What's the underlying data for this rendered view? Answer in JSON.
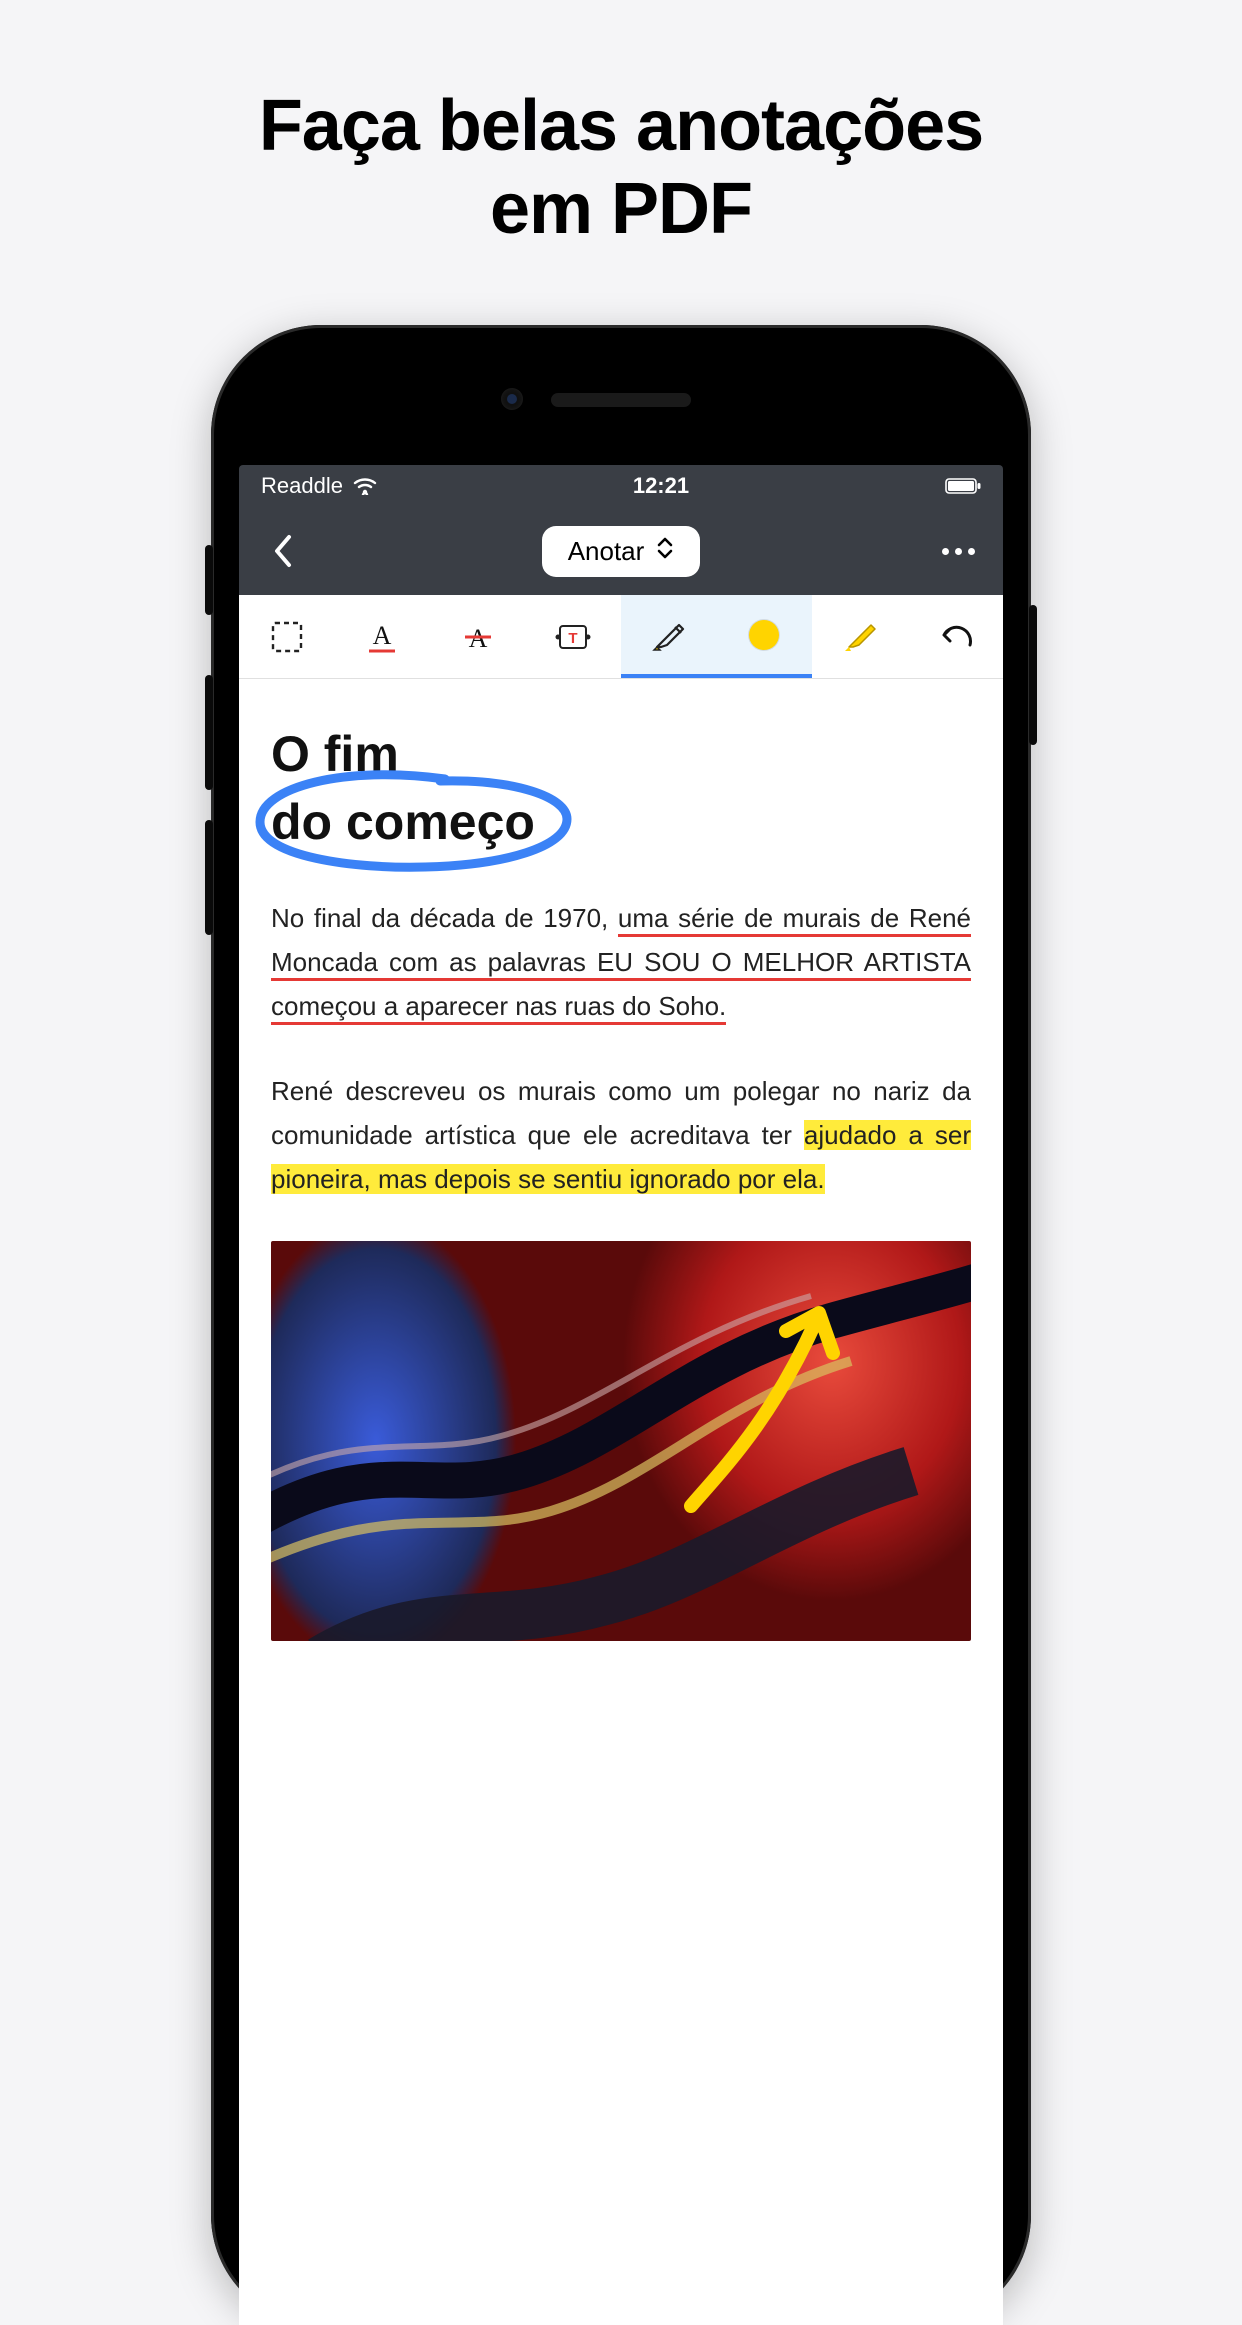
{
  "promo": {
    "title_line1": "Faça belas anotações",
    "title_line2": "em PDF"
  },
  "statusbar": {
    "carrier": "Readdle",
    "time": "12:21"
  },
  "navbar": {
    "mode_label": "Anotar"
  },
  "toolbar": {
    "tools": [
      {
        "name": "select-area",
        "selected": false
      },
      {
        "name": "text-underline",
        "selected": false
      },
      {
        "name": "text-strikethrough",
        "selected": false
      },
      {
        "name": "text-box",
        "selected": false
      },
      {
        "name": "highlighter-pen",
        "selected": true
      },
      {
        "name": "color",
        "selected": true,
        "color": "#ffd400"
      },
      {
        "name": "highlighter-marker",
        "selected": false
      },
      {
        "name": "undo",
        "selected": false
      }
    ]
  },
  "document": {
    "heading_line1": "O fim",
    "heading_line2": "do começo",
    "para1": {
      "plain": "No final da década de 1970, ",
      "underlined": "uma série de murais de René Moncada com as palavras EU SOU O MELHOR ARTISTA começou a aparecer nas ruas do Soho."
    },
    "para2": {
      "plain": "René descreveu os murais como um polegar no nariz da comunidade artística que ele acreditava ter ",
      "highlighted": "ajudado a ser pioneira, mas depois se sentiu ignorado por ela."
    }
  },
  "colors": {
    "highlight": "#ffeb3b",
    "underline": "#e53935",
    "circle": "#3b82f6",
    "arrow": "#ffd400"
  }
}
